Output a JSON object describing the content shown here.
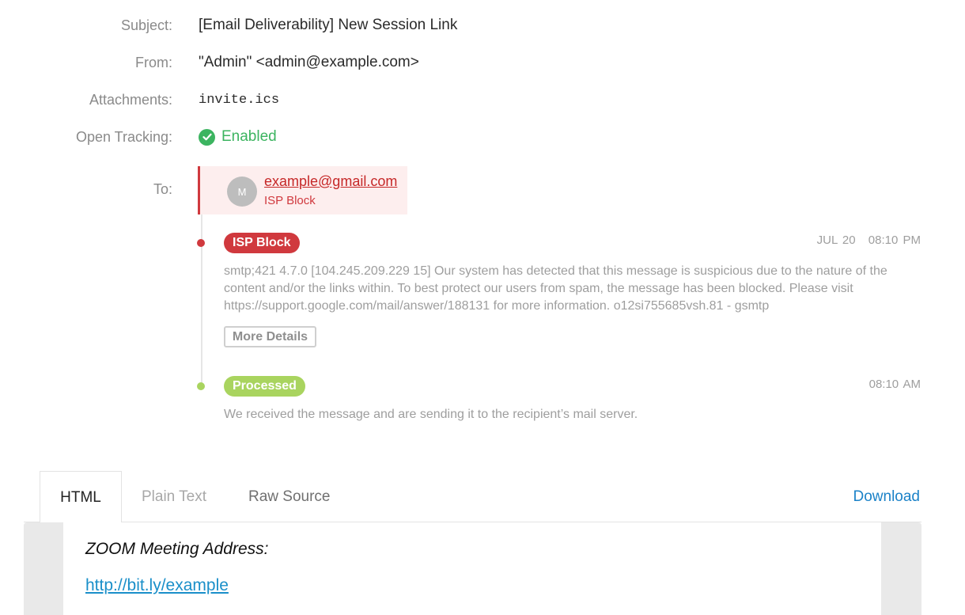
{
  "labels": {
    "subject": "Subject:",
    "from": "From:",
    "attachments": "Attachments:",
    "open_tracking": "Open Tracking:",
    "to": "To:"
  },
  "message": {
    "subject": "[Email Deliverability] New Session Link",
    "from": "\"Admin\" <admin@example.com>",
    "attachment": "invite.ics",
    "open_tracking": "Enabled"
  },
  "recipient": {
    "avatar_initial": "M",
    "email": "example@gmail.com",
    "status": "ISP Block"
  },
  "events": [
    {
      "badge": "ISP Block",
      "date": "JUL 20",
      "time": "08:10 PM",
      "text": "smtp;421 4.7.0 [104.245.209.229 15] Our system has detected that this message is suspicious due to the nature of the content and/or the links within. To best protect our users from spam, the message has been blocked. Please visit https://support.google.com/mail/answer/188131 for more information. o12si755685vsh.81 - gsmtp",
      "button": "More Details",
      "color": "#d0393e"
    },
    {
      "badge": "Processed",
      "time": "08:10 AM",
      "text": "We received the message and are sending it to the recipient’s mail server.",
      "color": "#a9d45f"
    }
  ],
  "tabs": {
    "html": "HTML",
    "plain_text": "Plain Text",
    "raw_source": "Raw Source",
    "download": "Download"
  },
  "preview": {
    "heading": "ZOOM Meeting Address:",
    "link": "http://bit.ly/example"
  },
  "colors": {
    "success": "#3cb460",
    "error": "#d0393e",
    "processed": "#a9d45f",
    "link": "#1b82c8"
  },
  "icons": {
    "tracking": "check-circle-icon"
  }
}
